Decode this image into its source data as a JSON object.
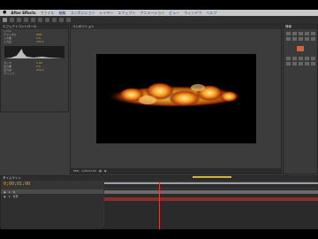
{
  "menubar": {
    "apple": "",
    "app_name": "After Effects",
    "items": [
      "ファイル",
      "編集",
      "コンポジション",
      "レイヤー",
      "エフェクト",
      "アニメーション",
      "ビュー",
      "ウィンドウ",
      "ヘルプ"
    ],
    "right_status": ""
  },
  "panels": {
    "effects_tab": "エフェクトコントロール",
    "viewer_tab": "コンポジション",
    "info_tab": "情報",
    "timeline_tab": "タイムライン"
  },
  "effect_rows": [
    {
      "label": "レベル",
      "value": ""
    },
    {
      "label": "チャンネル",
      "value": "RGB"
    },
    {
      "label": "入力黒",
      "value": "0.0"
    },
    {
      "label": "入力白",
      "value": "255.0"
    },
    {
      "label": "ガンマ",
      "value": "1.00"
    },
    {
      "label": "出力黒",
      "value": "0.0"
    },
    {
      "label": "出力白",
      "value": "255.0"
    },
    {
      "label": "クリップ",
      "value": ""
    }
  ],
  "viewer": {
    "zoom": "50%",
    "timecode_small": "0;00;01;00"
  },
  "timeline": {
    "timecode": "0;00;01;00",
    "layers": [
      {
        "num": "1",
        "name": "炎"
      },
      {
        "num": "2",
        "name": "背景"
      }
    ]
  },
  "colors": {
    "accent": "#d8a53a",
    "playhead": "#d94040",
    "fire_core": "#ffd27a",
    "fire_edge": "#c2410c"
  }
}
